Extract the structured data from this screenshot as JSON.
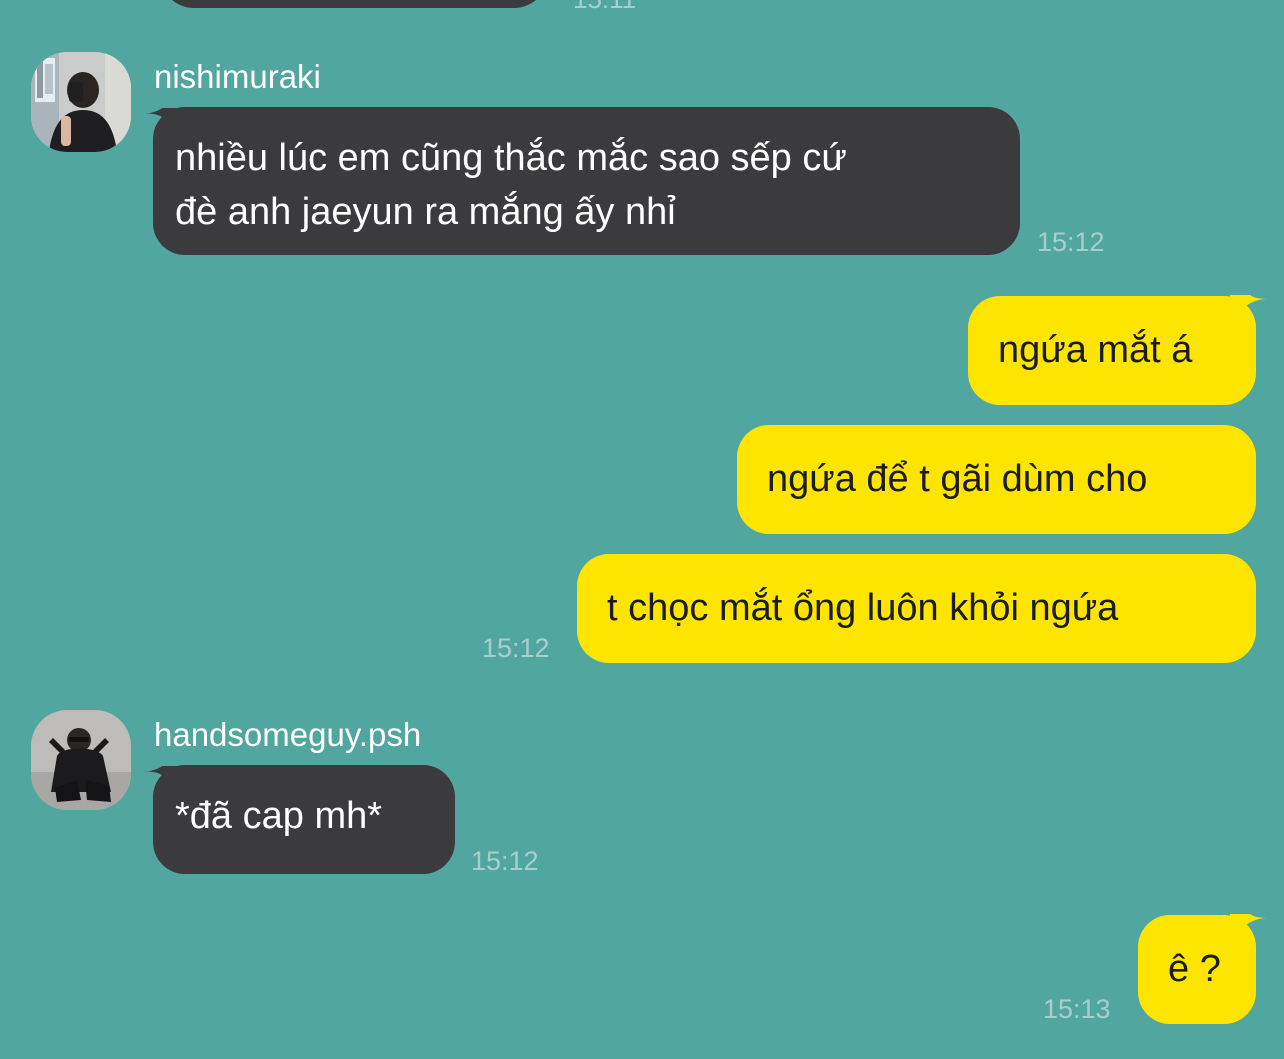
{
  "colors": {
    "background": "#51a6a0",
    "incoming_bubble": "#3b3b3d",
    "outgoing_bubble": "#fee500",
    "timestamp": "#a9cfcb"
  },
  "top_cut": {
    "time": "15:11"
  },
  "messages": [
    {
      "sender": "nishimuraki",
      "avatar_icon": "user-avatar-mirror-selfie",
      "text_lines": [
        "nhiều lúc em cũng thắc mắc sao sếp cứ",
        "đè anh jaeyun ra mắng ấy nhỉ"
      ],
      "time": "15:12"
    },
    {
      "sender": "me",
      "texts": [
        "ngứa mắt á",
        "ngứa để t gãi dùm cho",
        "t chọc mắt ổng luôn khỏi ngứa"
      ],
      "time": "15:12"
    },
    {
      "sender": "handsomeguy.psh",
      "avatar_icon": "user-avatar-crouching-sunglasses",
      "text": "*đã cap mh*",
      "time": "15:12"
    },
    {
      "sender": "me",
      "text": "ê ?",
      "time": "15:13"
    }
  ]
}
